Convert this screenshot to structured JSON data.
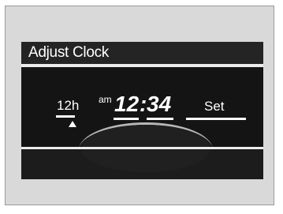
{
  "screen": {
    "title": "Adjust Clock"
  },
  "clock": {
    "format": "12h",
    "ampm": "am",
    "hour": "12",
    "separator": ":",
    "minute": "34",
    "set_label": "Set"
  },
  "colors": {
    "display_background": "#1a1a1a",
    "frame": "#d9d9d9",
    "text": "#ffffff",
    "rule": "#ececec"
  },
  "icons": {
    "format_cursor": "caret-up-icon"
  }
}
